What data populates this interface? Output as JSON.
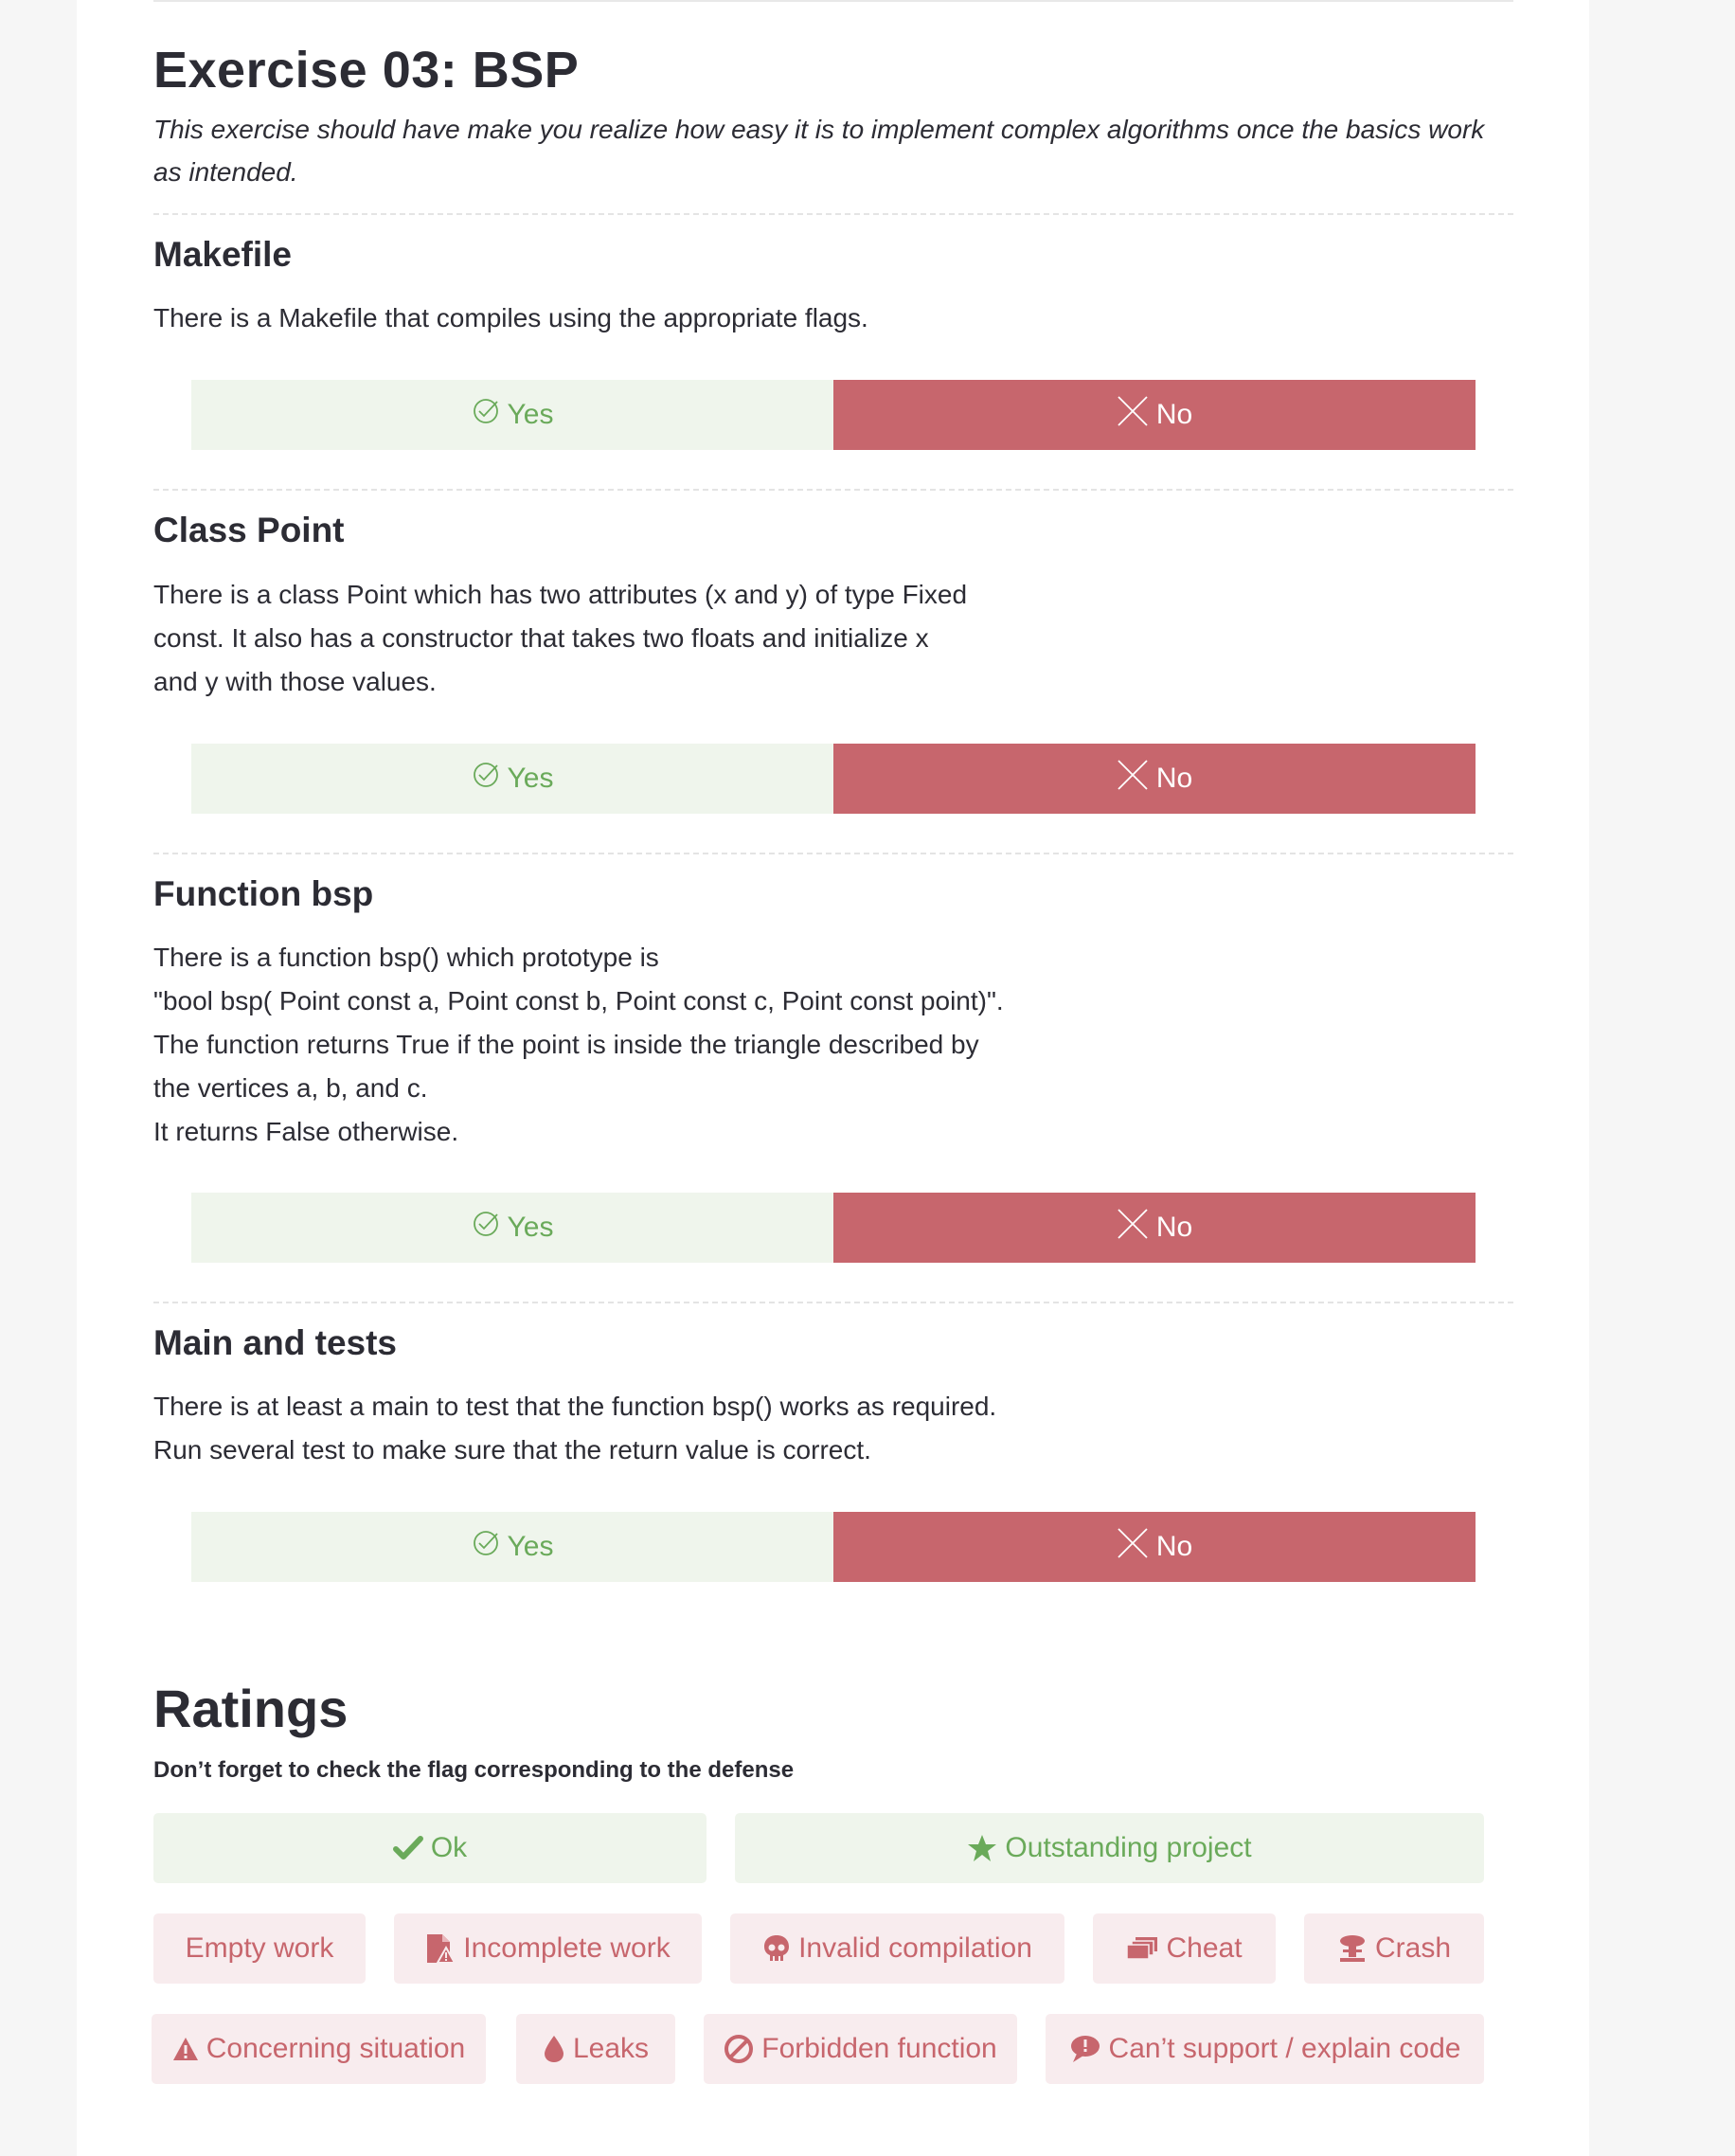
{
  "exercise": {
    "title": "Exercise 03: BSP",
    "subtitle": "This exercise should have make you realize how easy it is to implement complex algorithms once the basics work as intended."
  },
  "sections": [
    {
      "title": "Makefile",
      "lines": [
        "There is a Makefile that compiles using the appropriate flags."
      ],
      "yes_label": "Yes",
      "no_label": "No"
    },
    {
      "title": "Class Point",
      "lines": [
        "There is a class Point which has two attributes (x and y) of type Fixed",
        "const. It also has a constructor that takes two floats and initialize x",
        "and y with those values."
      ],
      "yes_label": "Yes",
      "no_label": "No"
    },
    {
      "title": "Function bsp",
      "lines": [
        "There is a function bsp() which prototype is",
        "\"bool bsp( Point const a, Point const b, Point const c, Point const point)\".",
        "The function returns True if the point is inside the triangle described by",
        "the vertices a, b, and c.",
        "It returns False otherwise."
      ],
      "yes_label": "Yes",
      "no_label": "No"
    },
    {
      "title": "Main and tests",
      "lines": [
        "There is at least a main to test that the function bsp() works as required.",
        "Run several test to make sure that the return value is correct."
      ],
      "yes_label": "Yes",
      "no_label": "No"
    }
  ],
  "ratings": {
    "title": "Ratings",
    "note": "Don’t forget to check the flag corresponding to the defense",
    "positive_flags": [
      {
        "label": "Ok",
        "icon": "check-icon"
      },
      {
        "label": "Outstanding project",
        "icon": "star-icon"
      }
    ],
    "negative_flags": [
      {
        "label": "Empty work",
        "icon": ""
      },
      {
        "label": "Incomplete work",
        "icon": "file-warning-icon"
      },
      {
        "label": "Invalid compilation",
        "icon": "skull-icon"
      },
      {
        "label": "Cheat",
        "icon": "stack-icon"
      },
      {
        "label": "Crash",
        "icon": "mushroom-cloud-icon"
      },
      {
        "label": "Concerning situation",
        "icon": "warning-icon"
      },
      {
        "label": "Leaks",
        "icon": "drop-icon"
      },
      {
        "label": "Forbidden function",
        "icon": "ban-icon"
      },
      {
        "label": "Can’t support / explain code",
        "icon": "speech-bubble-icon"
      }
    ]
  },
  "colors": {
    "yes_bg": "#eff5ec",
    "yes_text": "#6aaa5a",
    "no_bg": "#c7666d",
    "flag_bad_bg": "#f8ecee",
    "flag_bad_text": "#c7666d"
  }
}
